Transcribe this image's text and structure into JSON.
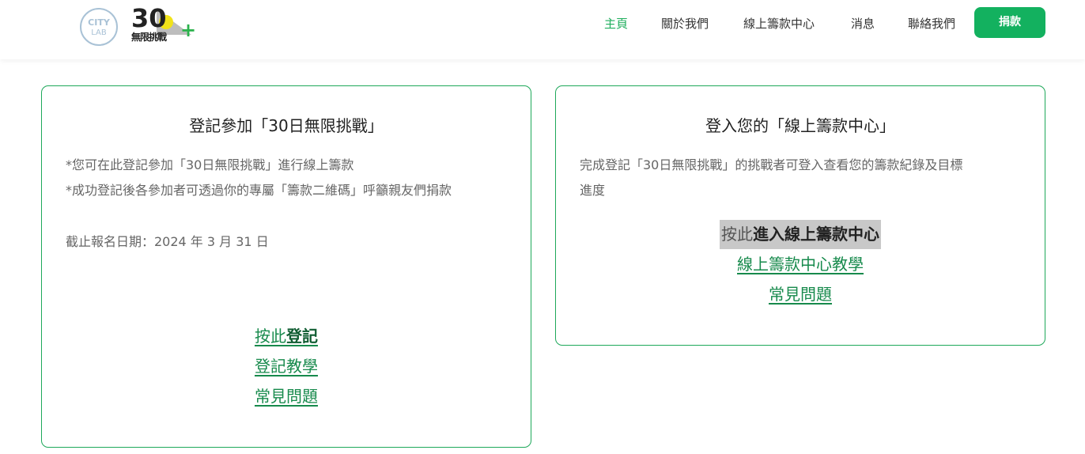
{
  "header": {
    "logo_left_alt": "CITY LAB",
    "logo_num": "30",
    "logo_text": "無限挑戰",
    "logo_plus": "+",
    "nav": [
      {
        "label": "主頁",
        "active": true
      },
      {
        "label": "關於我們",
        "active": false
      },
      {
        "label": "線上籌款中心",
        "active": false
      },
      {
        "label": "消息",
        "active": false
      },
      {
        "label": "聯絡我們",
        "active": false
      }
    ],
    "donate_label": "捐款"
  },
  "left_card": {
    "title": "登記參加「30日無限挑戰」",
    "line1": "*您可在此登記參加「30日無限挑戰」進行線上籌款",
    "line2": "*成功登記後各參加者可透過你的專屬「籌款二維碼」呼籲親友們捐款",
    "deadline": "截止報名日期：2024 年 3 月 31 日",
    "link1_prefix": "按此",
    "link1_bold": "登記",
    "link2": "登記教學",
    "link3": "常見問題"
  },
  "right_card": {
    "title": "登入您的「線上籌款中心」",
    "line1": "完成登記「30日無限挑戰」的挑戰者可登入查看您的籌款紀錄及目標",
    "line2": "進度",
    "link1_prefix": "按此",
    "link1_bold": "進入線上籌款中心",
    "link2": "線上籌款中心教學",
    "link3": "常見問題"
  },
  "colors": {
    "accent": "#13b15f",
    "border": "#1ea85a",
    "link": "#178a4c"
  }
}
